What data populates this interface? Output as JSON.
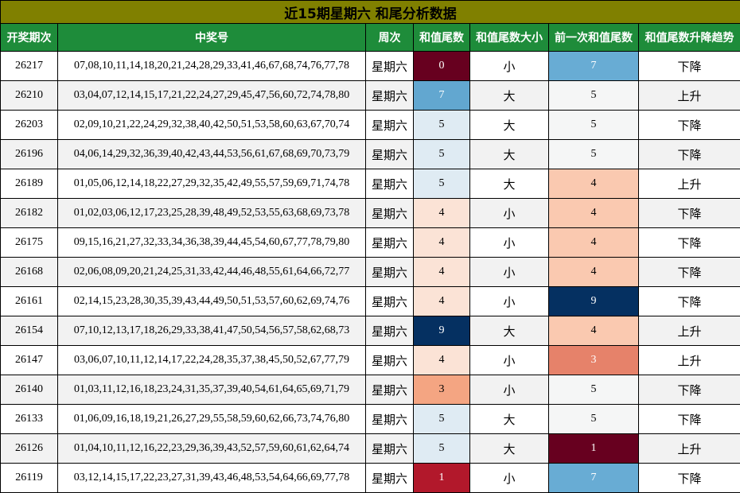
{
  "title": "近15期星期六 和尾分析数据",
  "colors": {
    "title_bg": "#808000",
    "header_bg": "#1e8c3a",
    "header_text": "#ffffff",
    "row_alt": "#f2f2f2"
  },
  "headers": [
    "开奖期次",
    "中奖号",
    "周次",
    "和值尾数",
    "和值尾数大小",
    "前一次和值尾数",
    "和值尾数升降趋势"
  ],
  "value_colors": {
    "0": {
      "bg": "#67001f",
      "fg": "#ffffff"
    },
    "1": {
      "bg": "#b2182b",
      "fg": "#ffffff"
    },
    "3": {
      "bg": "#f4a582",
      "fg": "#000000"
    },
    "4": {
      "bg": "#fbe3d6",
      "fg": "#000000"
    },
    "5": {
      "bg": "#dfebf3",
      "fg": "#000000"
    },
    "7": {
      "bg": "#62a7d0",
      "fg": "#ffffff"
    },
    "9": {
      "bg": "#053061",
      "fg": "#ffffff"
    }
  },
  "prev_colors": {
    "1": {
      "bg": "#67001f",
      "fg": "#ffffff"
    },
    "3": {
      "bg": "#e6826a",
      "fg": "#ffffff"
    },
    "4": {
      "bg": "#fac9b0",
      "fg": "#000000"
    },
    "5": {
      "bg": "#f5f6f6",
      "fg": "#000000"
    },
    "7": {
      "bg": "#68acd4",
      "fg": "#ffffff"
    },
    "9": {
      "bg": "#053061",
      "fg": "#ffffff"
    }
  },
  "rows": [
    {
      "period": "26217",
      "numbers": "07,08,10,11,14,18,20,21,24,28,29,33,41,46,67,68,74,76,77,78",
      "weekday": "星期六",
      "tail": "0",
      "size": "小",
      "prev": "7",
      "trend": "下降"
    },
    {
      "period": "26210",
      "numbers": "03,04,07,12,14,15,17,21,22,24,27,29,45,47,56,60,72,74,78,80",
      "weekday": "星期六",
      "tail": "7",
      "size": "大",
      "prev": "5",
      "trend": "上升"
    },
    {
      "period": "26203",
      "numbers": "02,09,10,21,22,24,29,32,38,40,42,50,51,53,58,60,63,67,70,74",
      "weekday": "星期六",
      "tail": "5",
      "size": "大",
      "prev": "5",
      "trend": "下降"
    },
    {
      "period": "26196",
      "numbers": "04,06,14,29,32,36,39,40,42,43,44,53,56,61,67,68,69,70,73,79",
      "weekday": "星期六",
      "tail": "5",
      "size": "大",
      "prev": "5",
      "trend": "下降"
    },
    {
      "period": "26189",
      "numbers": "01,05,06,12,14,18,22,27,29,32,35,42,49,55,57,59,69,71,74,78",
      "weekday": "星期六",
      "tail": "5",
      "size": "大",
      "prev": "4",
      "trend": "上升"
    },
    {
      "period": "26182",
      "numbers": "01,02,03,06,12,17,23,25,28,39,48,49,52,53,55,63,68,69,73,78",
      "weekday": "星期六",
      "tail": "4",
      "size": "小",
      "prev": "4",
      "trend": "下降"
    },
    {
      "period": "26175",
      "numbers": "09,15,16,21,27,32,33,34,36,38,39,44,45,54,60,67,77,78,79,80",
      "weekday": "星期六",
      "tail": "4",
      "size": "小",
      "prev": "4",
      "trend": "下降"
    },
    {
      "period": "26168",
      "numbers": "02,06,08,09,20,21,24,25,31,33,42,44,46,48,55,61,64,66,72,77",
      "weekday": "星期六",
      "tail": "4",
      "size": "小",
      "prev": "4",
      "trend": "下降"
    },
    {
      "period": "26161",
      "numbers": "02,14,15,23,28,30,35,39,43,44,49,50,51,53,57,60,62,69,74,76",
      "weekday": "星期六",
      "tail": "4",
      "size": "小",
      "prev": "9",
      "trend": "下降"
    },
    {
      "period": "26154",
      "numbers": "07,10,12,13,17,18,26,29,33,38,41,47,50,54,56,57,58,62,68,73",
      "weekday": "星期六",
      "tail": "9",
      "size": "大",
      "prev": "4",
      "trend": "上升"
    },
    {
      "period": "26147",
      "numbers": "03,06,07,10,11,12,14,17,22,24,28,35,37,38,45,50,52,67,77,79",
      "weekday": "星期六",
      "tail": "4",
      "size": "小",
      "prev": "3",
      "trend": "上升"
    },
    {
      "period": "26140",
      "numbers": "01,03,11,12,16,18,23,24,31,35,37,39,40,54,61,64,65,69,71,79",
      "weekday": "星期六",
      "tail": "3",
      "size": "小",
      "prev": "5",
      "trend": "下降"
    },
    {
      "period": "26133",
      "numbers": "01,06,09,16,18,19,21,26,27,29,55,58,59,60,62,66,73,74,76,80",
      "weekday": "星期六",
      "tail": "5",
      "size": "大",
      "prev": "5",
      "trend": "下降"
    },
    {
      "period": "26126",
      "numbers": "01,04,10,11,12,16,22,23,29,36,39,43,52,57,59,60,61,62,64,74",
      "weekday": "星期六",
      "tail": "5",
      "size": "大",
      "prev": "1",
      "trend": "上升"
    },
    {
      "period": "26119",
      "numbers": "03,12,14,15,17,22,23,27,31,39,43,46,48,53,54,64,66,69,77,78",
      "weekday": "星期六",
      "tail": "1",
      "size": "小",
      "prev": "7",
      "trend": "下降"
    }
  ]
}
